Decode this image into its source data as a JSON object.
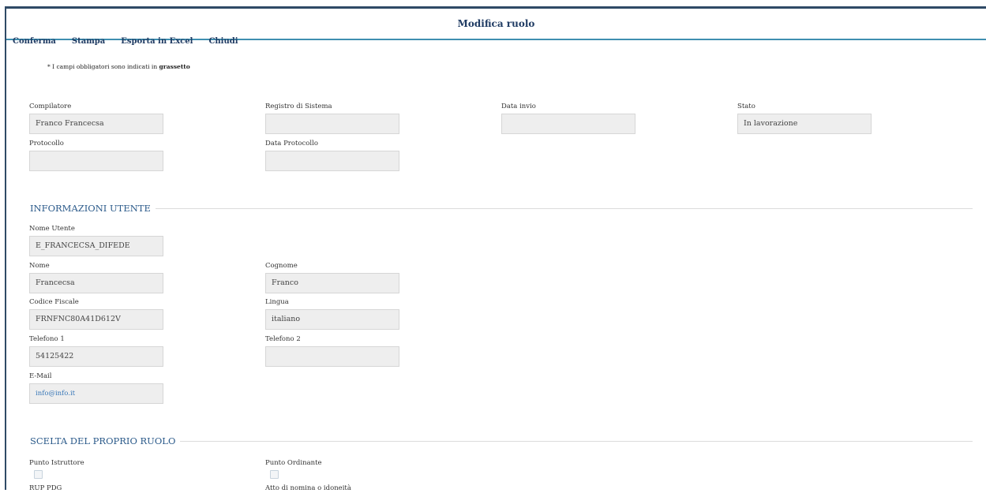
{
  "header": {
    "title": "Modifica ruolo"
  },
  "toolbar": {
    "confirm": "Conferma",
    "print": "Stampa",
    "export": "Esporta in Excel",
    "close": "Chiudi"
  },
  "note": {
    "text": "* I campi obbligatori sono indicati in ",
    "bold": "grassetto"
  },
  "meta": {
    "compilatore": {
      "label": "Compilatore",
      "value": "Franco Francecsa"
    },
    "registro": {
      "label": "Registro di Sistema",
      "value": ""
    },
    "data_invio": {
      "label": "Data invio",
      "value": ""
    },
    "stato": {
      "label": "Stato",
      "value": "In lavorazione"
    },
    "protocollo": {
      "label": "Protocollo",
      "value": ""
    },
    "data_protocollo": {
      "label": "Data Protocollo",
      "value": ""
    }
  },
  "user_section": {
    "title": "INFORMAZIONI UTENTE",
    "nome_utente": {
      "label": "Nome Utente",
      "value": "E_FRANCECSA_DIFEDE"
    },
    "nome": {
      "label": "Nome",
      "value": "Francecsa"
    },
    "cognome": {
      "label": "Cognome",
      "value": "Franco"
    },
    "codice_fiscale": {
      "label": "Codice Fiscale",
      "value": "FRNFNC80A41D612V"
    },
    "lingua": {
      "label": "Lingua",
      "value": "italiano"
    },
    "telefono1": {
      "label": "Telefono 1",
      "value": "54125422"
    },
    "telefono2": {
      "label": "Telefono 2",
      "value": ""
    },
    "email": {
      "label": "E-Mail",
      "value": "info@info.it"
    }
  },
  "role_section": {
    "title": "SCELTA DEL PROPRIO RUOLO",
    "punto_istruttore": {
      "label": "Punto Istruttore",
      "checked": false
    },
    "punto_ordinante": {
      "label": "Punto Ordinante",
      "checked": false
    },
    "rup_pdg": {
      "label": "RUP PDG"
    },
    "atto_nomina": {
      "label": "Atto di nomina o idoneità"
    }
  }
}
